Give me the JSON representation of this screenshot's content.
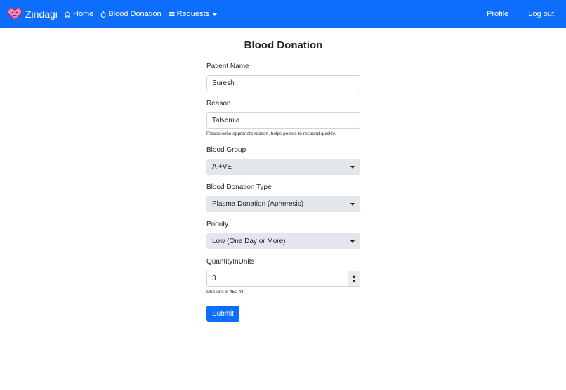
{
  "colors": {
    "brand": "#0d6efd",
    "select_bg": "#e3e6ea",
    "text": "#212529"
  },
  "navbar": {
    "brand_name": "Zindagi",
    "left_links": [
      {
        "label": "Home",
        "icon": "home-icon"
      },
      {
        "label": "Blood Donation",
        "icon": "drop-icon"
      },
      {
        "label": "Requests",
        "icon": "menu-icon"
      }
    ],
    "right_links": [
      {
        "label": "Profile"
      },
      {
        "label": "Log out"
      }
    ]
  },
  "form": {
    "title": "Blood Donation",
    "patient_name": {
      "label": "Patient Name",
      "value": "Suresh"
    },
    "reason": {
      "label": "Reason",
      "value": "Talsemia",
      "help": "Please write approriate reason, helps people to respond quickly."
    },
    "blood_group": {
      "label": "Blood Group",
      "selected": "A +VE"
    },
    "donation_type": {
      "label": "Blood Donation Type",
      "selected": "Plasma Donation (Apheresis)"
    },
    "priority": {
      "label": "Priority",
      "selected": "Low (One Day or More)"
    },
    "quantity": {
      "label": "QuantityInUnits",
      "value": "3",
      "help": "One unit is 450 ml."
    },
    "submit_label": "Submit"
  }
}
